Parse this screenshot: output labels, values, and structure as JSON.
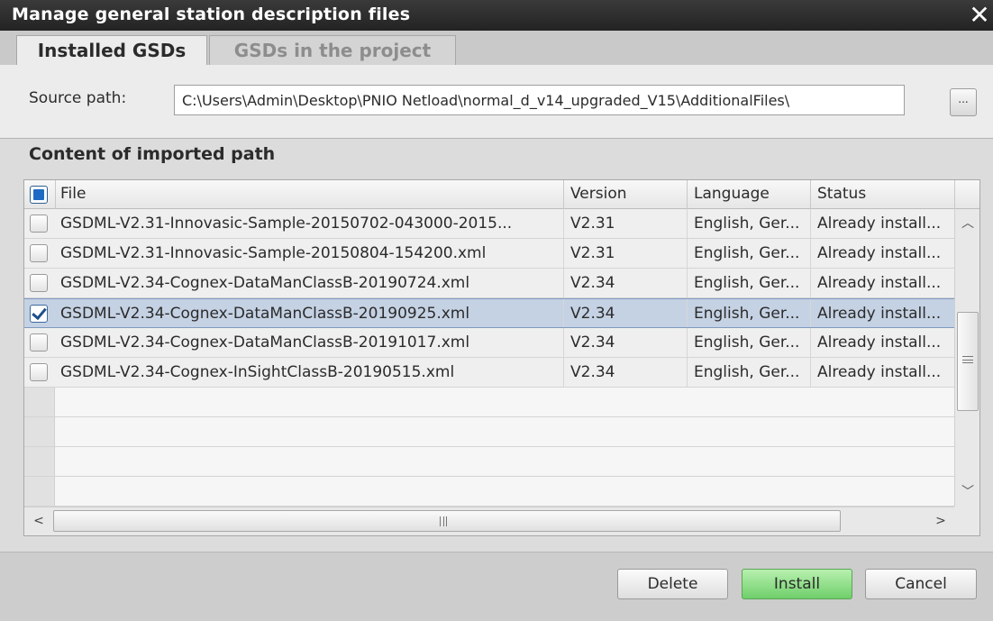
{
  "window": {
    "title": "Manage general station description files",
    "close_glyph": "✕"
  },
  "tabs": [
    {
      "label": "Installed GSDs",
      "active": true
    },
    {
      "label": "GSDs in the project",
      "active": false
    }
  ],
  "source": {
    "label": "Source path:",
    "value": "C:\\Users\\Admin\\Desktop\\PNIO Netload\\normal_d_v14_upgraded_V15\\AdditionalFiles\\",
    "browse_label": "..."
  },
  "content": {
    "heading": "Content of imported path",
    "columns": {
      "file": "File",
      "version": "Version",
      "language": "Language",
      "status": "Status"
    },
    "header_checkbox_state": "partial",
    "rows": [
      {
        "file": "GSDML-V2.31-Innovasic-Sample-20150702-043000-2015...",
        "version": "V2.31",
        "language": "English, Ger...",
        "status": "Already install...",
        "checked": false
      },
      {
        "file": "GSDML-V2.31-Innovasic-Sample-20150804-154200.xml",
        "version": "V2.31",
        "language": "English, Ger...",
        "status": "Already install...",
        "checked": false
      },
      {
        "file": "GSDML-V2.34-Cognex-DataManClassB-20190724.xml",
        "version": "V2.34",
        "language": "English, Ger...",
        "status": "Already install...",
        "checked": false
      },
      {
        "file": "GSDML-V2.34-Cognex-DataManClassB-20190925.xml",
        "version": "V2.34",
        "language": "English, Ger...",
        "status": "Already install...",
        "checked": true,
        "selected": true
      },
      {
        "file": "GSDML-V2.34-Cognex-DataManClassB-20191017.xml",
        "version": "V2.34",
        "language": "English, Ger...",
        "status": "Already install...",
        "checked": false
      },
      {
        "file": "GSDML-V2.34-Cognex-InSightClassB-20190515.xml",
        "version": "V2.34",
        "language": "English, Ger...",
        "status": "Already install...",
        "checked": false
      }
    ],
    "empty_rows": 4
  },
  "scrollbars": {
    "up_glyph": "︿",
    "down_glyph": "﹀",
    "left_glyph": "<",
    "right_glyph": ">"
  },
  "buttons": {
    "delete": "Delete",
    "install": "Install",
    "cancel": "Cancel"
  },
  "colors": {
    "titlebar": "#2d2d2d",
    "selected_row": "#c5d2e4",
    "install_button": "#7fd878",
    "checkbox_accent": "#1d6ac4"
  },
  "icons": {
    "close": "close-icon",
    "browse": "ellipsis-icon",
    "checkbox_checked": "checkmark-icon",
    "scroll_up": "chevron-up-icon",
    "scroll_down": "chevron-down-icon",
    "scroll_left": "chevron-left-icon",
    "scroll_right": "chevron-right-icon"
  }
}
